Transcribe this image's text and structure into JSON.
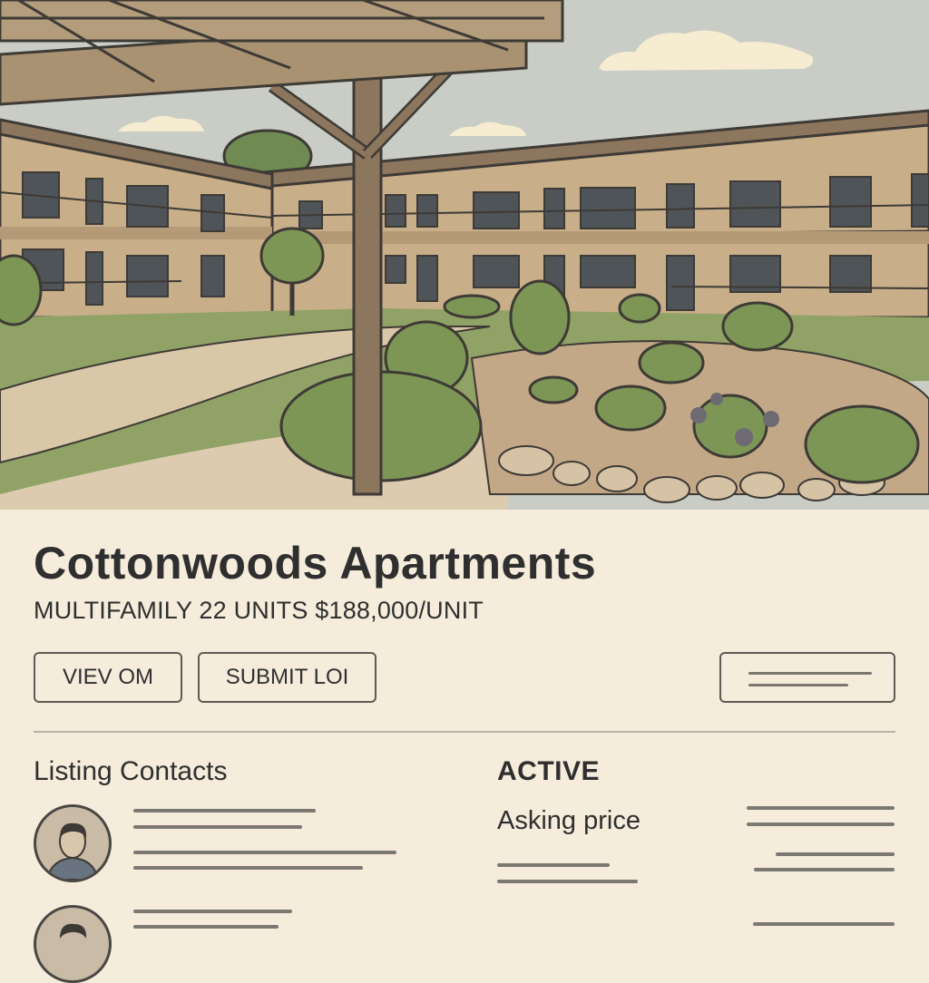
{
  "listing": {
    "title": "Cottonwoods Apartments",
    "subtitle": "MULTIFAMILY 22 UNITS $188,000/UNIT",
    "status": "ACTIVE"
  },
  "actions": {
    "view_om_label": "VIEV OM",
    "submit_loi_label": "SUBMIT LOI"
  },
  "contacts": {
    "section_title": "Listing Contacts"
  },
  "pricing": {
    "asking_label": "Asking price"
  },
  "icons": {
    "more": "more-lines-icon",
    "avatar": "person-avatar-icon"
  },
  "colors": {
    "background": "#f5ecdc",
    "text": "#2f2f2f",
    "border": "#5e5a55"
  }
}
